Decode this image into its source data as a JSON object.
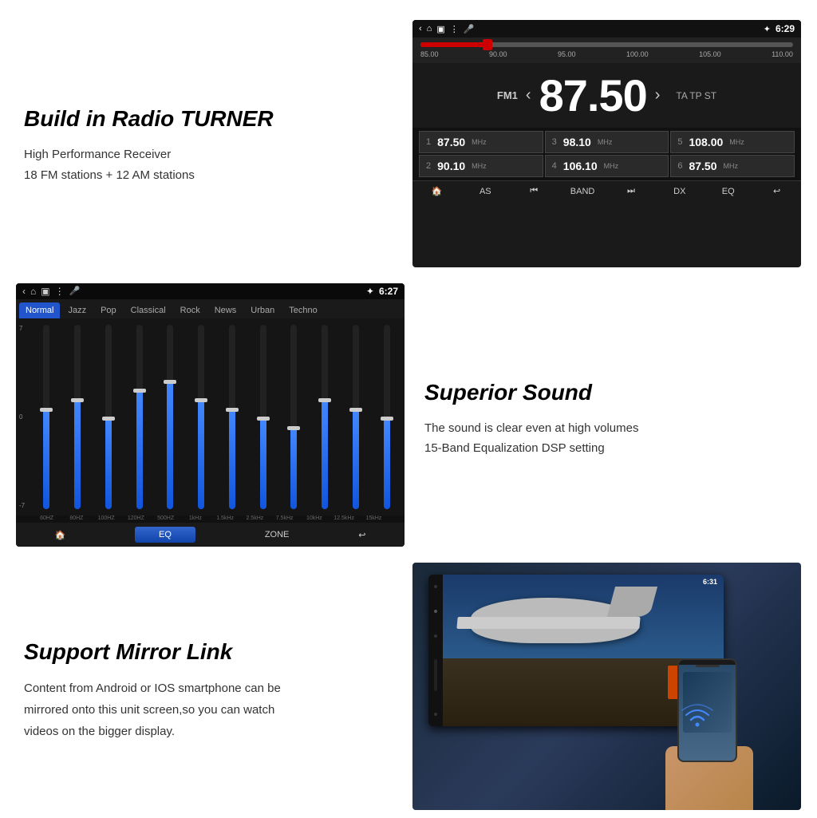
{
  "sections": {
    "radio": {
      "title": "Build in Radio TURNER",
      "desc1": "High Performance Receiver",
      "desc2": "18 FM stations + 12 AM stations",
      "screen": {
        "statusTime": "6:29",
        "freqLabel": "FM1",
        "freqNumber": "87.50",
        "freqLabels": [
          "85.00",
          "90.00",
          "95.00",
          "100.00",
          "105.00",
          "110.00"
        ],
        "taInfo": "TA TP ST",
        "presets": [
          {
            "num": "1",
            "freq": "87.50",
            "unit": "MHz"
          },
          {
            "num": "3",
            "freq": "98.10",
            "unit": "MHz"
          },
          {
            "num": "5",
            "freq": "108.00",
            "unit": "MHz"
          },
          {
            "num": "2",
            "freq": "90.10",
            "unit": "MHz"
          },
          {
            "num": "4",
            "freq": "106.10",
            "unit": "MHz"
          },
          {
            "num": "6",
            "freq": "87.50",
            "unit": "MHz"
          }
        ],
        "navButtons": [
          "🏠",
          "AS",
          "⏮",
          "BAND",
          "⏭",
          "DX",
          "EQ",
          "↩"
        ]
      }
    },
    "equalizer": {
      "statusTime": "6:27",
      "tabs": [
        "Normal",
        "Jazz",
        "Pop",
        "Classical",
        "Rock",
        "News",
        "Urban",
        "Techno"
      ],
      "activeTab": "Normal",
      "scaleTop": "7",
      "scaleMid": "0",
      "scaleBot": "-7",
      "bands": [
        {
          "freq": "60HZ",
          "fill": 55,
          "thumbPos": 45
        },
        {
          "freq": "80HZ",
          "fill": 60,
          "thumbPos": 40
        },
        {
          "freq": "100HZ",
          "fill": 50,
          "thumbPos": 50
        },
        {
          "freq": "120HZ",
          "fill": 65,
          "thumbPos": 35
        },
        {
          "freq": "500HZ",
          "fill": 70,
          "thumbPos": 30
        },
        {
          "freq": "1kHz",
          "fill": 60,
          "thumbPos": 40
        },
        {
          "freq": "1.5kHz",
          "fill": 55,
          "thumbPos": 45
        },
        {
          "freq": "2.5kHz",
          "fill": 50,
          "thumbPos": 50
        },
        {
          "freq": "7.5kHz",
          "fill": 45,
          "thumbPos": 55
        },
        {
          "freq": "10kHz",
          "fill": 60,
          "thumbPos": 40
        },
        {
          "freq": "12.5kHz",
          "fill": 55,
          "thumbPos": 45
        },
        {
          "freq": "15kHz",
          "fill": 50,
          "thumbPos": 50
        }
      ],
      "bottomButtons": [
        "🏠",
        "EQ",
        "ZONE",
        "↩"
      ]
    },
    "sound": {
      "title": "Superior Sound",
      "desc1": "The sound is clear even at high volumes",
      "desc2": "15-Band Equalization DSP setting"
    },
    "mirror": {
      "title": "Support Mirror Link",
      "desc": "Content from Android or IOS smartphone can be mirrored onto this unit screen,so you can watch videos on the  bigger display.",
      "screenTime": "6:31"
    }
  }
}
